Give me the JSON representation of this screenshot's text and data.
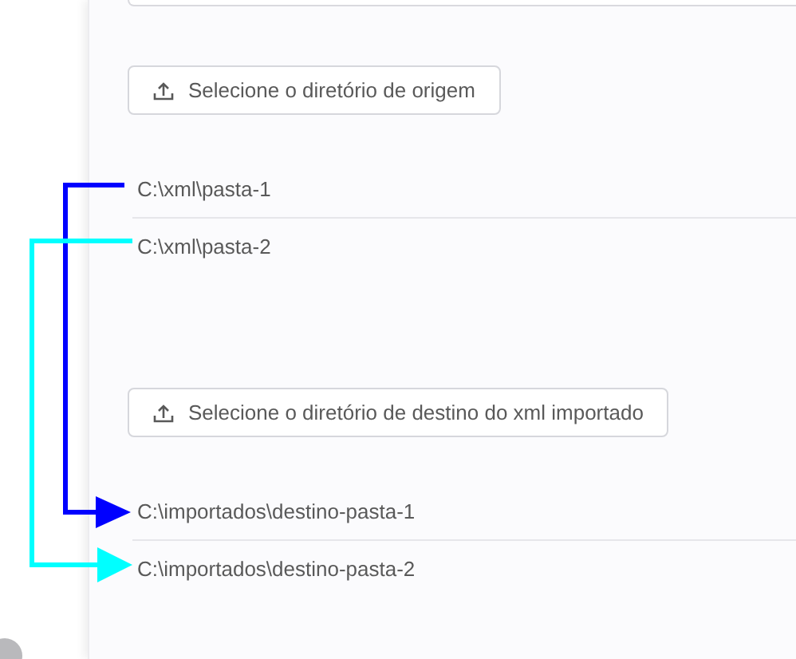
{
  "sections": [
    {
      "button": "Selecione o diretório de origem",
      "paths": [
        "C:\\xml\\pasta-1",
        "C:\\xml\\pasta-2"
      ]
    },
    {
      "button": "Selecione o diretório de destino do xml importado",
      "paths": [
        "C:\\importados\\destino-pasta-1",
        "C:\\importados\\destino-pasta-2"
      ]
    }
  ],
  "links": [
    {
      "color": "#0000ff"
    },
    {
      "color": "#00ffff"
    }
  ]
}
